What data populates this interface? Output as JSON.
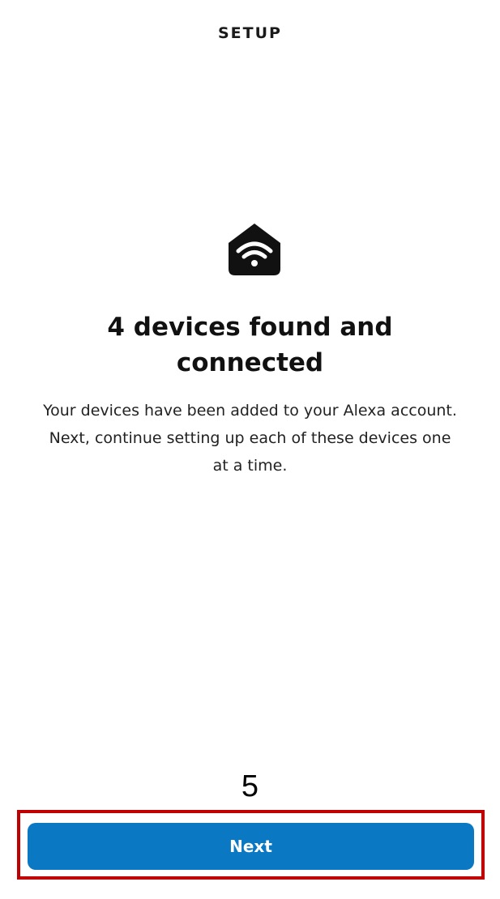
{
  "header": {
    "title": "SETUP"
  },
  "content": {
    "icon": "home-wifi-icon",
    "headline": "4 devices found and connected",
    "description": "Your devices have been added to your Alexa account. Next, continue setting up each of these devices one at a time."
  },
  "annotation": {
    "step_number": "5",
    "highlight_color": "#c00000"
  },
  "footer": {
    "next_label": "Next",
    "button_color": "#0a78c2"
  }
}
